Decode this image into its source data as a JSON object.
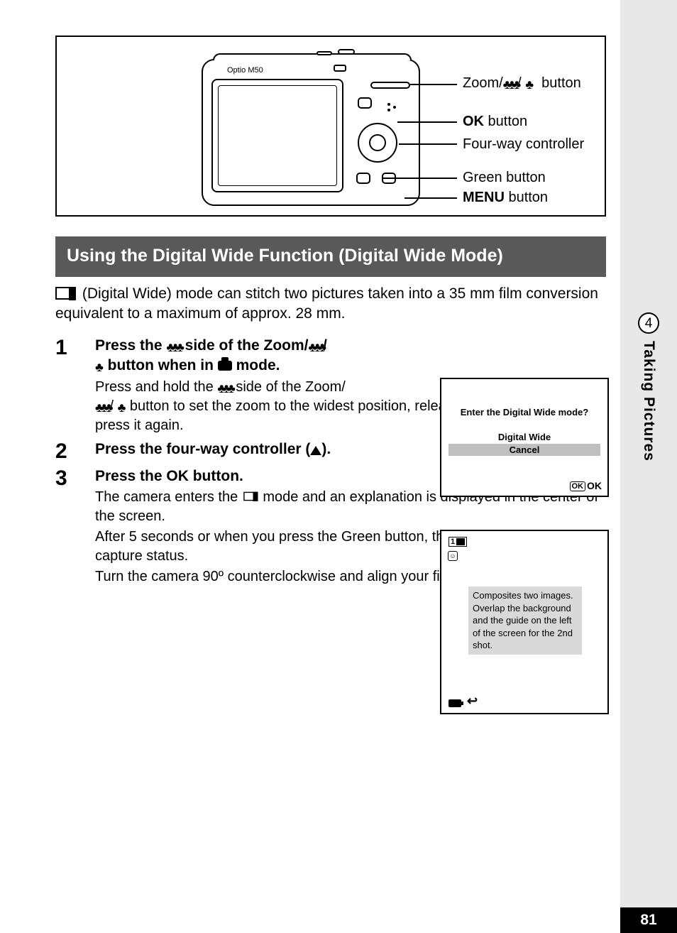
{
  "camera": {
    "model": "Optio M50",
    "labels": {
      "zoom": "Zoom/♣♣♣/ ♣  button",
      "ok": "OK",
      "ok_suffix": " button",
      "fourway": "Four-way controller",
      "green": "Green button",
      "menu": "MENU",
      "menu_suffix": " button"
    }
  },
  "heading": "Using the Digital Wide Function (Digital Wide Mode)",
  "intro": {
    "after_icon": "(Digital Wide) mode can stitch two pictures taken into a 35 mm film conversion equivalent to a maximum of approx. 28 mm."
  },
  "steps": [
    {
      "num": "1",
      "title_pre": "Press the ",
      "title_mid": " side of the Zoom/",
      "title_line2_pre": " button when in ",
      "title_line2_post": " mode.",
      "body_l1_pre": "Press and hold the ",
      "body_l1_post": " side of the Zoom/",
      "body_l2": " button to set the zoom to the widest position, release the button, and then press it again."
    },
    {
      "num": "2",
      "title": "Press the four-way controller (",
      "title_post": ")."
    },
    {
      "num": "3",
      "title_pre": "Press the ",
      "title_post": " button.",
      "body1_pre": "The camera enters the ",
      "body1_post": " mode and an explanation is displayed in the center of the screen.",
      "body2": "After 5 seconds or when you press the Green button, the camera returns to capture status.",
      "body3": "Turn the camera 90º counterclockwise and align your first picture."
    }
  ],
  "lcd1": {
    "question": "Enter the Digital Wide mode?",
    "opt1": "Digital Wide",
    "opt2": "Cancel",
    "ok_box": "OK",
    "ok": "OK"
  },
  "lcd2": {
    "badge_num": "1",
    "message": "Composites two images. Overlap the background and the guide on the left of the screen for the 2nd shot.",
    "return": "↩"
  },
  "side": {
    "chapter": "4",
    "label": "Taking Pictures"
  },
  "page_number": "81"
}
